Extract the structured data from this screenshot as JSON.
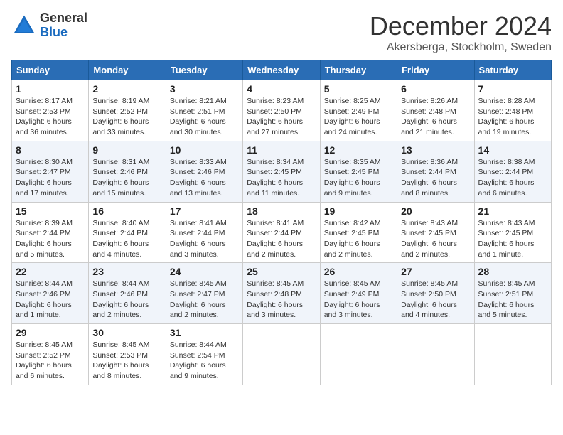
{
  "header": {
    "logo_general": "General",
    "logo_blue": "Blue",
    "month_title": "December 2024",
    "subtitle": "Akersberga, Stockholm, Sweden"
  },
  "weekdays": [
    "Sunday",
    "Monday",
    "Tuesday",
    "Wednesday",
    "Thursday",
    "Friday",
    "Saturday"
  ],
  "weeks": [
    [
      {
        "day": "1",
        "info": "Sunrise: 8:17 AM\nSunset: 2:53 PM\nDaylight: 6 hours and 36 minutes."
      },
      {
        "day": "2",
        "info": "Sunrise: 8:19 AM\nSunset: 2:52 PM\nDaylight: 6 hours and 33 minutes."
      },
      {
        "day": "3",
        "info": "Sunrise: 8:21 AM\nSunset: 2:51 PM\nDaylight: 6 hours and 30 minutes."
      },
      {
        "day": "4",
        "info": "Sunrise: 8:23 AM\nSunset: 2:50 PM\nDaylight: 6 hours and 27 minutes."
      },
      {
        "day": "5",
        "info": "Sunrise: 8:25 AM\nSunset: 2:49 PM\nDaylight: 6 hours and 24 minutes."
      },
      {
        "day": "6",
        "info": "Sunrise: 8:26 AM\nSunset: 2:48 PM\nDaylight: 6 hours and 21 minutes."
      },
      {
        "day": "7",
        "info": "Sunrise: 8:28 AM\nSunset: 2:48 PM\nDaylight: 6 hours and 19 minutes."
      }
    ],
    [
      {
        "day": "8",
        "info": "Sunrise: 8:30 AM\nSunset: 2:47 PM\nDaylight: 6 hours and 17 minutes."
      },
      {
        "day": "9",
        "info": "Sunrise: 8:31 AM\nSunset: 2:46 PM\nDaylight: 6 hours and 15 minutes."
      },
      {
        "day": "10",
        "info": "Sunrise: 8:33 AM\nSunset: 2:46 PM\nDaylight: 6 hours and 13 minutes."
      },
      {
        "day": "11",
        "info": "Sunrise: 8:34 AM\nSunset: 2:45 PM\nDaylight: 6 hours and 11 minutes."
      },
      {
        "day": "12",
        "info": "Sunrise: 8:35 AM\nSunset: 2:45 PM\nDaylight: 6 hours and 9 minutes."
      },
      {
        "day": "13",
        "info": "Sunrise: 8:36 AM\nSunset: 2:44 PM\nDaylight: 6 hours and 8 minutes."
      },
      {
        "day": "14",
        "info": "Sunrise: 8:38 AM\nSunset: 2:44 PM\nDaylight: 6 hours and 6 minutes."
      }
    ],
    [
      {
        "day": "15",
        "info": "Sunrise: 8:39 AM\nSunset: 2:44 PM\nDaylight: 6 hours and 5 minutes."
      },
      {
        "day": "16",
        "info": "Sunrise: 8:40 AM\nSunset: 2:44 PM\nDaylight: 6 hours and 4 minutes."
      },
      {
        "day": "17",
        "info": "Sunrise: 8:41 AM\nSunset: 2:44 PM\nDaylight: 6 hours and 3 minutes."
      },
      {
        "day": "18",
        "info": "Sunrise: 8:41 AM\nSunset: 2:44 PM\nDaylight: 6 hours and 2 minutes."
      },
      {
        "day": "19",
        "info": "Sunrise: 8:42 AM\nSunset: 2:45 PM\nDaylight: 6 hours and 2 minutes."
      },
      {
        "day": "20",
        "info": "Sunrise: 8:43 AM\nSunset: 2:45 PM\nDaylight: 6 hours and 2 minutes."
      },
      {
        "day": "21",
        "info": "Sunrise: 8:43 AM\nSunset: 2:45 PM\nDaylight: 6 hours and 1 minute."
      }
    ],
    [
      {
        "day": "22",
        "info": "Sunrise: 8:44 AM\nSunset: 2:46 PM\nDaylight: 6 hours and 1 minute."
      },
      {
        "day": "23",
        "info": "Sunrise: 8:44 AM\nSunset: 2:46 PM\nDaylight: 6 hours and 2 minutes."
      },
      {
        "day": "24",
        "info": "Sunrise: 8:45 AM\nSunset: 2:47 PM\nDaylight: 6 hours and 2 minutes."
      },
      {
        "day": "25",
        "info": "Sunrise: 8:45 AM\nSunset: 2:48 PM\nDaylight: 6 hours and 3 minutes."
      },
      {
        "day": "26",
        "info": "Sunrise: 8:45 AM\nSunset: 2:49 PM\nDaylight: 6 hours and 3 minutes."
      },
      {
        "day": "27",
        "info": "Sunrise: 8:45 AM\nSunset: 2:50 PM\nDaylight: 6 hours and 4 minutes."
      },
      {
        "day": "28",
        "info": "Sunrise: 8:45 AM\nSunset: 2:51 PM\nDaylight: 6 hours and 5 minutes."
      }
    ],
    [
      {
        "day": "29",
        "info": "Sunrise: 8:45 AM\nSunset: 2:52 PM\nDaylight: 6 hours and 6 minutes."
      },
      {
        "day": "30",
        "info": "Sunrise: 8:45 AM\nSunset: 2:53 PM\nDaylight: 6 hours and 8 minutes."
      },
      {
        "day": "31",
        "info": "Sunrise: 8:44 AM\nSunset: 2:54 PM\nDaylight: 6 hours and 9 minutes."
      },
      null,
      null,
      null,
      null
    ]
  ]
}
